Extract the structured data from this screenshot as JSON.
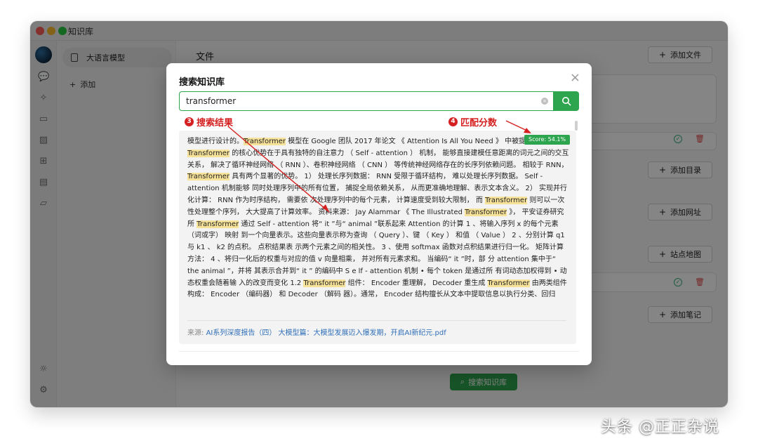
{
  "window": {
    "title": "知识库"
  },
  "sidebar": {
    "kb_item": "大语言模型",
    "add_label": "添加"
  },
  "main": {
    "file_section_title": "文件",
    "add_file": "添加文件",
    "add_directory": "添加目录",
    "add_url": "添加网址",
    "sitemap": "站点地图",
    "add_note": "添加笔记",
    "search_kb": "搜索知识库"
  },
  "modal": {
    "title": "搜索知识库",
    "search_value": "transformer",
    "score": "Score: 54.1%",
    "annotation_results": "搜索结果",
    "annotation_results_num": "3",
    "annotation_score": "匹配分数",
    "annotation_score_num": "4",
    "source_label": "来源:",
    "source_file": "AI系列深度报告（四） 大模型篇：大模型发展迈入爆发期，开启AI新纪元.pdf",
    "result_segments": [
      {
        "t": "模型进行设计的。",
        "h": false
      },
      {
        "t": "Transformer",
        "h": true
      },
      {
        "t": " 模型在 Google 团队 2017 年论文 《 Attention Is All You Need 》 中被提出。",
        "h": false
      },
      {
        "t": "Transformer",
        "h": true
      },
      {
        "t": " 的核心优势在于具有独特的自注意力 （ Self - attention ） 机制， 能够直接建模任意距离的词元之间的交互关系， 解决了循环神经网络 （ RNN ）、卷积神经网络 （ CNN ） 等传统神经网络存在的长序列依赖问题。 相较于 RNN， ",
        "h": false
      },
      {
        "t": "Transformer",
        "h": true
      },
      {
        "t": " 具有两个显著的优势。 1） 处理长序列数据： RNN 受限于循环结构， 难以处理长序列数据。 Self - attention 机制能够 同时处理序列中的所有位置， 捕捉全局依赖关系， 从而更准确地理解、表示文本含义。 2） 实现并行化计算： RNN 作为时序结构， 需要依 次处理序列中的每个元素， 计算速度受到较大限制， 而 ",
        "h": false
      },
      {
        "t": "Transformer",
        "h": true
      },
      {
        "t": " 则可以一次性处理整个序列， 大大提高了计算效率。 资料来源： Jay Alammar 《 The Illustrated ",
        "h": false
      },
      {
        "t": "Transformer",
        "h": true
      },
      {
        "t": " 》， 平安证券研究所 ",
        "h": false
      },
      {
        "t": "Transformer",
        "h": true
      },
      {
        "t": " 通过 Self - attention 将“ it ”与“ animal ”联系起来 Attention 的计算 1 、将输入序列 x 的每个元素 （词或字） 映射 到一个向量表示。这些向量表示称为查询 （ Query ）、键 （ Key ） 和值 （ Value ） 2 、分别计算 q1 与 k1 、 k2 的点积。 点积结果表 示两个元素之间的相关性。 3 、使用 softmax 函数对点积结果进行归一化。 矩阵计算方法： 4 、将归一化后的权重与对应的值 v 向量相乘， 并对所有元素求和。 当编码“ it ”时，部 分 attention 集中于“ the animal ”，并将 其表示合并到“ it ” 的编码中 S e lf - attention 机制 • 每个 token 是通过所 有词动态加权得到 • 动态权重会随着输 入的改变而变化 1.2 ",
        "h": false
      },
      {
        "t": "Transformer",
        "h": true
      },
      {
        "t": " 组件： Encoder 重理解， Decoder 重生成 ",
        "h": false
      },
      {
        "t": "Transformer",
        "h": true
      },
      {
        "t": " 由两类组件构成： Encoder （编码器） 和 Decoder （解码 器）。通常， Encoder 结构擅长从文本中提取信息以执行分类、回归",
        "h": false
      }
    ]
  },
  "watermark": "头条 @正正杂说",
  "colors": {
    "accent": "#2da44e",
    "highlight": "#f7e29a",
    "annotation": "#d42020",
    "link": "#2f6fb8"
  }
}
